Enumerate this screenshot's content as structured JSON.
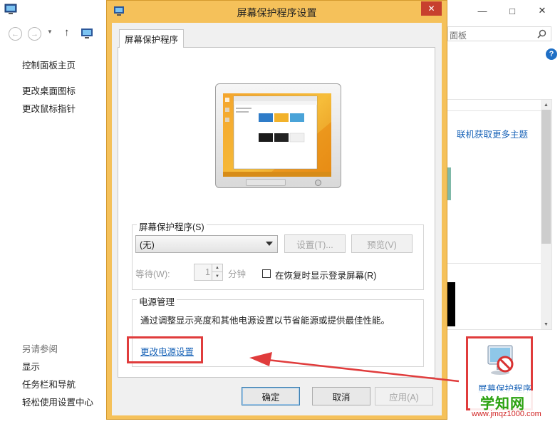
{
  "background_window": {
    "search_placeholder": "面板",
    "left_nav": {
      "home": "控制面板主页",
      "change_desktop_icons": "更改桌面图标",
      "change_mouse_pointer": "更改鼠标指针"
    },
    "see_also": {
      "heading": "另请参阅",
      "items": [
        "显示",
        "任务栏和导航",
        "轻松使用设置中心"
      ]
    },
    "online_themes_link": "联机获取更多主题",
    "screensaver_tile_label": "屏幕保护程序"
  },
  "dialog": {
    "title": "屏幕保护程序设置",
    "tab_label": "屏幕保护程序",
    "screensaver_group": {
      "legend": "屏幕保护程序(S)",
      "selected": "(无)",
      "settings_button": "设置(T)...",
      "preview_button": "预览(V)",
      "wait_label": "等待(W):",
      "wait_value": "1",
      "minutes_label": "分钟",
      "resume_checkbox_label": "在恢复时显示登录屏幕(R)",
      "resume_checked": false
    },
    "power_group": {
      "legend": "电源管理",
      "description": "通过调整显示亮度和其他电源设置以节省能源或提供最佳性能。",
      "link": "更改电源设置"
    },
    "buttons": {
      "ok": "确定",
      "cancel": "取消",
      "apply": "应用(A)"
    }
  },
  "watermark": {
    "logo": "学知网",
    "url": "www.jmqz1000.com"
  },
  "colors": {
    "dialog_frame": "#f5c15a",
    "annotation_red": "#e03c3c",
    "link_blue": "#1a64b8",
    "close_red": "#c7402e"
  }
}
